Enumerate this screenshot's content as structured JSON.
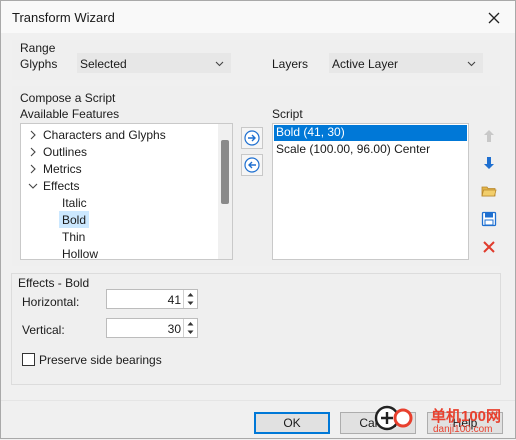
{
  "window": {
    "title": "Transform Wizard",
    "close_icon": "close-icon"
  },
  "range": {
    "heading": "Range",
    "glyphs_label": "Glyphs",
    "glyphs_value": "Selected",
    "layers_label": "Layers",
    "layers_value": "Active Layer"
  },
  "compose": {
    "heading": "Compose a Script",
    "available_label": "Available Features",
    "script_label": "Script",
    "tree": [
      {
        "label": "Characters and Glyphs",
        "expander": "chevron-right-icon"
      },
      {
        "label": "Outlines",
        "expander": "chevron-right-icon"
      },
      {
        "label": "Metrics",
        "expander": "chevron-right-icon"
      },
      {
        "label": "Effects",
        "expander": "chevron-down-icon"
      },
      {
        "label": "Italic"
      },
      {
        "label": "Bold",
        "selected": true
      },
      {
        "label": "Thin"
      },
      {
        "label": "Hollow"
      }
    ],
    "script_items": [
      {
        "label": "Bold (41, 30)",
        "selected": true
      },
      {
        "label": "Scale (100.00, 96.00) Center"
      }
    ],
    "add_icon": "arrow-right-circle-icon",
    "remove_icon": "arrow-left-circle-icon",
    "tools": [
      {
        "icon": "arrow-up-icon",
        "enabled": false
      },
      {
        "icon": "arrow-down-icon",
        "enabled": true
      },
      {
        "icon": "open-folder-icon",
        "enabled": true
      },
      {
        "icon": "save-disk-icon",
        "enabled": true
      },
      {
        "icon": "delete-x-icon",
        "enabled": true
      }
    ]
  },
  "effects": {
    "heading": "Effects - Bold",
    "horizontal_label": "Horizontal:",
    "horizontal_value": "41",
    "vertical_label": "Vertical:",
    "vertical_value": "30",
    "preserve_label": "Preserve side bearings",
    "preserve_checked": false
  },
  "footer": {
    "ok": "OK",
    "cancel": "Cancel",
    "help": "Help"
  },
  "watermark": {
    "text_cn": "单机100网",
    "text_url": "danji100.com"
  },
  "colors": {
    "accent": "#0078d7",
    "tree_selection": "#cce8ff",
    "blue_arrow": "#1e6fd0",
    "red_x": "#e03b2c",
    "watermark": "#e8402e"
  }
}
